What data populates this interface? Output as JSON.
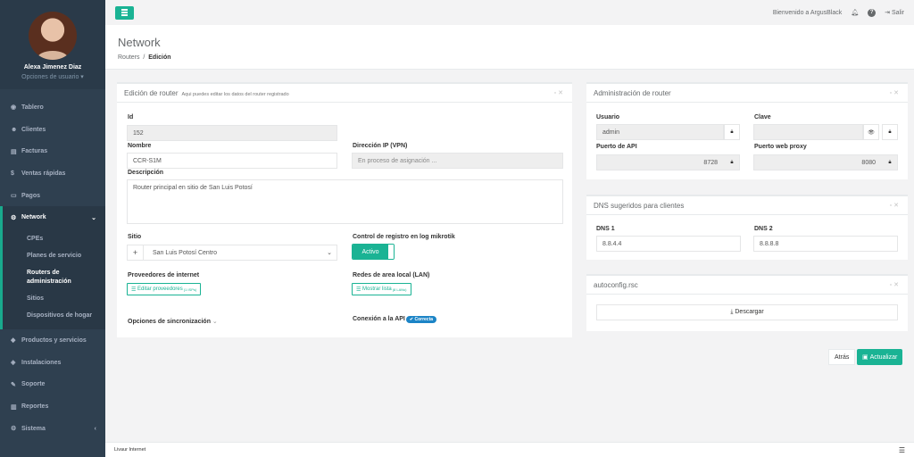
{
  "profile": {
    "name": "Alexa Jimenez Diaz",
    "options": "Opciones de usuario ▾"
  },
  "sidebar": {
    "items": [
      {
        "icon": "tachometer-icon",
        "glyph": "◉",
        "label": "Tablero"
      },
      {
        "icon": "users-icon",
        "glyph": "☻",
        "label": "Clientes"
      },
      {
        "icon": "file-icon",
        "glyph": "▤",
        "label": "Facturas"
      },
      {
        "icon": "dollar-icon",
        "glyph": "$",
        "label": "Ventas rápidas"
      },
      {
        "icon": "money-icon",
        "glyph": "▭",
        "label": "Pagos"
      }
    ],
    "active": {
      "glyph": "⚙",
      "label": "Network",
      "chevron": "⌄"
    },
    "subitems": [
      "CPEs",
      "Planes de servicio",
      "Routers de administración",
      "Sitios",
      "Dispositivos de hogar"
    ],
    "items_after": [
      {
        "icon": "cubes-icon",
        "glyph": "◆",
        "label": "Productos y servicios"
      },
      {
        "icon": "tag-icon",
        "glyph": "◈",
        "label": "Instalaciones"
      },
      {
        "icon": "wrench-icon",
        "glyph": "✎",
        "label": "Soporte"
      },
      {
        "icon": "bar-chart-icon",
        "glyph": "▥",
        "label": "Reportes"
      }
    ],
    "last": {
      "glyph": "⚙",
      "label": "Sistema",
      "chevron": "‹"
    }
  },
  "topbar": {
    "welcome": "Bienvenido a ArgusBlack",
    "logout": "Salir"
  },
  "page": {
    "title": "Network",
    "crumb_parent": "Routers",
    "crumb_sep": "/",
    "crumb_current": "Edición"
  },
  "edit_panel": {
    "title": "Edición de router",
    "subtitle": "Aqui puedes editar los datos del router registrado",
    "id_label": "Id",
    "id_value": "152",
    "name_label": "Nombre",
    "name_value": "CCR-S1M",
    "vpn_label": "Dirección IP (VPN)",
    "vpn_placeholder": "En proceso de asignación ...",
    "desc_label": "Descripción",
    "desc_value": "Router principal en sitio de San Luis Potosí",
    "site_label": "Sitio",
    "site_value": "San Luis Potosí Centro",
    "log_label": "Control de registro en log mikrotik",
    "log_value": "Activo",
    "providers_label": "Proveedores de internet",
    "providers_btn": "Editar proveedores",
    "providers_count": "(1 ISPs)",
    "lan_label": "Redes de area local (LAN)",
    "lan_btn": "Mostrar lista",
    "lan_count": "(8 LANs)",
    "sync_label": "Opciones de sincronización",
    "conn_label": "Conexión a la API",
    "conn_status": "✔ Correcta"
  },
  "admin_panel": {
    "title": "Administración de router",
    "user_label": "Usuario",
    "user_value": "admin",
    "pass_label": "Clave",
    "pass_value": "",
    "api_label": "Puerto de API",
    "api_value": "8728",
    "proxy_label": "Puerto web proxy",
    "proxy_value": "8080"
  },
  "dns_panel": {
    "title": "DNS sugeridos para clientes",
    "dns1_label": "DNS 1",
    "dns1_value": "8.8.4.4",
    "dns2_label": "DNS 2",
    "dns2_value": "8.8.8.8"
  },
  "autoconfig_panel": {
    "title": "autoconfig.rsc",
    "download": "⤓ Descargar"
  },
  "actions": {
    "back": "Atrás",
    "update": "Actualizar"
  },
  "footer": {
    "left": "Livaur Internet"
  },
  "colors": {
    "accent": "#1ab394",
    "sidebar": "#2f4050",
    "badge": "#1c84c6"
  }
}
